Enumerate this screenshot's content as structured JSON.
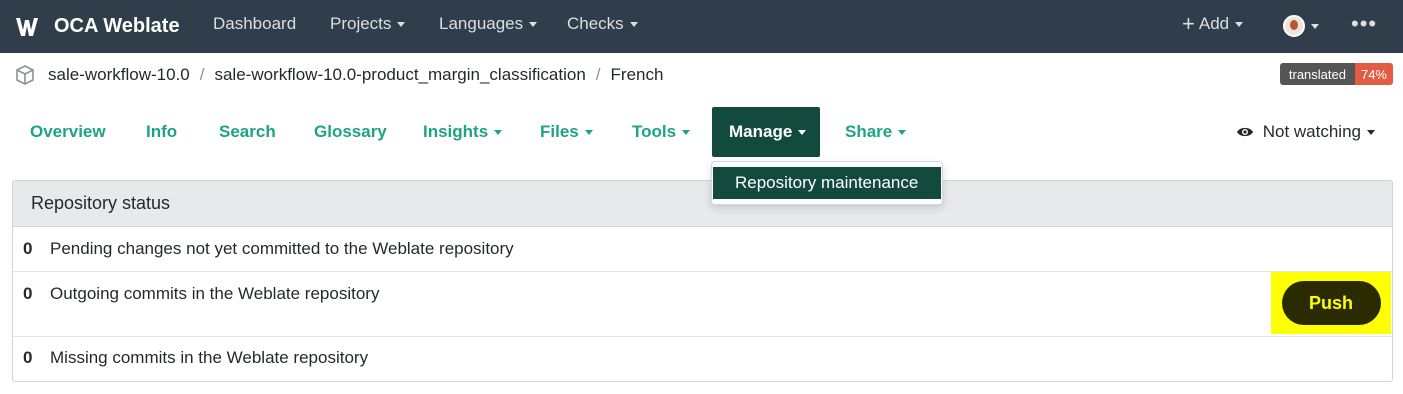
{
  "app": {
    "name": "OCA Weblate"
  },
  "navbar": {
    "items": [
      {
        "label": "Dashboard",
        "has_caret": false
      },
      {
        "label": "Projects",
        "has_caret": true
      },
      {
        "label": "Languages",
        "has_caret": true
      },
      {
        "label": "Checks",
        "has_caret": true
      }
    ],
    "add_label": "Add",
    "more_icon": "ellipsis-icon"
  },
  "breadcrumb": {
    "items": [
      "sale-workflow-10.0",
      "sale-workflow-10.0-product_margin_classification",
      "French"
    ],
    "separator": "/"
  },
  "badge": {
    "label": "translated",
    "value": "74%",
    "color": "#e05d44"
  },
  "tabs": [
    {
      "label": "Overview",
      "has_caret": false
    },
    {
      "label": "Info",
      "has_caret": false
    },
    {
      "label": "Search",
      "has_caret": false
    },
    {
      "label": "Glossary",
      "has_caret": false
    },
    {
      "label": "Insights",
      "has_caret": true
    },
    {
      "label": "Files",
      "has_caret": true
    },
    {
      "label": "Tools",
      "has_caret": true
    },
    {
      "label": "Manage",
      "has_caret": true,
      "active": true
    },
    {
      "label": "Share",
      "has_caret": true
    }
  ],
  "watch": {
    "label": "Not watching"
  },
  "dropdown": {
    "items": [
      {
        "label": "Repository maintenance"
      }
    ]
  },
  "repo_status": {
    "title": "Repository status",
    "rows": [
      {
        "count": "0",
        "label": "Pending changes not yet committed to the Weblate repository"
      },
      {
        "count": "0",
        "label": "Outgoing commits in the Weblate repository"
      },
      {
        "count": "0",
        "label": "Missing commits in the Weblate repository"
      }
    ],
    "push_label": "Push"
  },
  "colors": {
    "navbar_bg": "#2f3e4a",
    "accent": "#1fa385",
    "active_tab": "#124a3d",
    "highlight": "#ffff00"
  }
}
